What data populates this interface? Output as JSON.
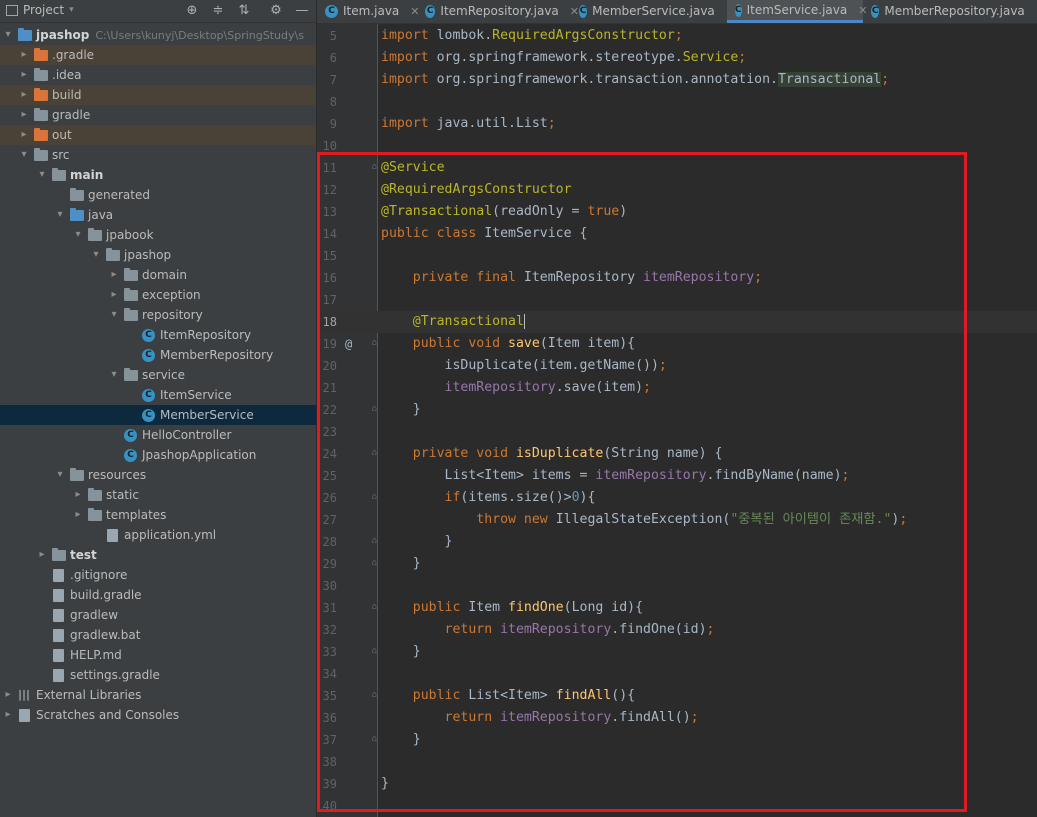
{
  "project_panel": {
    "title": "Project",
    "tree": [
      {
        "label": "jpashop",
        "path": "C:\\Users\\kunyj\\Desktop\\SpringStudy\\s",
        "bold": true,
        "icon": "folder-blue",
        "depth": 0,
        "arrow": "▾"
      },
      {
        "label": ".gradle",
        "icon": "folder-orange",
        "depth": 1,
        "arrow": "▸",
        "hl": true
      },
      {
        "label": ".idea",
        "icon": "folder",
        "depth": 1,
        "arrow": "▸"
      },
      {
        "label": "build",
        "icon": "folder-orange",
        "depth": 1,
        "arrow": "▸",
        "hl": true
      },
      {
        "label": "gradle",
        "icon": "folder",
        "depth": 1,
        "arrow": "▸"
      },
      {
        "label": "out",
        "icon": "folder-orange",
        "depth": 1,
        "arrow": "▸",
        "hl": true
      },
      {
        "label": "src",
        "icon": "folder",
        "depth": 1,
        "arrow": "▾"
      },
      {
        "label": "main",
        "bold": true,
        "icon": "folder",
        "depth": 2,
        "arrow": "▾"
      },
      {
        "label": "generated",
        "icon": "folder",
        "depth": 3,
        "arrow": ""
      },
      {
        "label": "java",
        "icon": "folder-blue",
        "depth": 3,
        "arrow": "▾"
      },
      {
        "label": "jpabook",
        "icon": "folder",
        "depth": 4,
        "arrow": "▾"
      },
      {
        "label": "jpashop",
        "icon": "folder",
        "depth": 5,
        "arrow": "▾"
      },
      {
        "label": "domain",
        "icon": "folder",
        "depth": 6,
        "arrow": "▸"
      },
      {
        "label": "exception",
        "icon": "folder",
        "depth": 6,
        "arrow": "▸"
      },
      {
        "label": "repository",
        "icon": "folder",
        "depth": 6,
        "arrow": "▾"
      },
      {
        "label": "ItemRepository",
        "icon": "class",
        "depth": 7,
        "arrow": ""
      },
      {
        "label": "MemberRepository",
        "icon": "class",
        "depth": 7,
        "arrow": ""
      },
      {
        "label": "service",
        "icon": "folder",
        "depth": 6,
        "arrow": "▾"
      },
      {
        "label": "ItemService",
        "icon": "class",
        "depth": 7,
        "arrow": ""
      },
      {
        "label": "MemberService",
        "icon": "class",
        "depth": 7,
        "arrow": "",
        "sel": true
      },
      {
        "label": "HelloController",
        "icon": "class",
        "depth": 6,
        "arrow": ""
      },
      {
        "label": "JpashopApplication",
        "icon": "class",
        "depth": 6,
        "arrow": ""
      },
      {
        "label": "resources",
        "icon": "folder",
        "depth": 3,
        "arrow": "▾"
      },
      {
        "label": "static",
        "icon": "folder",
        "depth": 4,
        "arrow": "▸"
      },
      {
        "label": "templates",
        "icon": "folder",
        "depth": 4,
        "arrow": "▸"
      },
      {
        "label": "application.yml",
        "icon": "file",
        "depth": 5,
        "arrow": ""
      },
      {
        "label": "test",
        "bold": true,
        "icon": "folder",
        "depth": 2,
        "arrow": "▸"
      },
      {
        "label": ".gitignore",
        "icon": "file",
        "depth": 2,
        "arrow": ""
      },
      {
        "label": "build.gradle",
        "icon": "file",
        "depth": 2,
        "arrow": ""
      },
      {
        "label": "gradlew",
        "icon": "file",
        "depth": 2,
        "arrow": ""
      },
      {
        "label": "gradlew.bat",
        "icon": "file",
        "depth": 2,
        "arrow": ""
      },
      {
        "label": "HELP.md",
        "icon": "file",
        "depth": 2,
        "arrow": ""
      },
      {
        "label": "settings.gradle",
        "icon": "file",
        "depth": 2,
        "arrow": ""
      },
      {
        "label": "External Libraries",
        "icon": "library",
        "depth": 0,
        "arrow": "▸"
      },
      {
        "label": "Scratches and Consoles",
        "icon": "scratch",
        "depth": 0,
        "arrow": "▸"
      }
    ]
  },
  "tabs": [
    {
      "label": "Item.java",
      "active": false
    },
    {
      "label": "ItemRepository.java",
      "active": false
    },
    {
      "label": "MemberService.java",
      "active": false
    },
    {
      "label": "ItemService.java",
      "active": true
    },
    {
      "label": "MemberRepository.java",
      "active": false
    }
  ],
  "editor": {
    "current_line": 18,
    "lines": [
      {
        "n": "5",
        "t": [
          [
            "kw",
            "import "
          ],
          [
            "mt",
            "lombok."
          ],
          [
            "an",
            "RequiredArgsConstructor"
          ],
          [
            "kw",
            ";"
          ]
        ]
      },
      {
        "n": "6",
        "t": [
          [
            "kw",
            "import "
          ],
          [
            "mt",
            "org.springframework.stereotype."
          ],
          [
            "an",
            "Service"
          ],
          [
            "kw",
            ";"
          ]
        ]
      },
      {
        "n": "7",
        "t": [
          [
            "kw",
            "import "
          ],
          [
            "mt",
            "org.springframework.transaction.annotation."
          ],
          [
            "annhl",
            "Transactional"
          ],
          [
            "kw",
            ";"
          ]
        ]
      },
      {
        "n": "8",
        "t": []
      },
      {
        "n": "9",
        "t": [
          [
            "kw",
            "import "
          ],
          [
            "mt",
            "java.util.List"
          ],
          [
            "kw",
            ";"
          ]
        ]
      },
      {
        "n": "10",
        "t": []
      },
      {
        "n": "11",
        "t": [
          [
            "an",
            "@Service"
          ]
        ]
      },
      {
        "n": "12",
        "t": [
          [
            "an",
            "@RequiredArgsConstructor"
          ]
        ]
      },
      {
        "n": "13",
        "t": [
          [
            "an",
            "@Transactional"
          ],
          [
            "mt",
            "(readOnly = "
          ],
          [
            "kw",
            "true"
          ],
          [
            "mt",
            ")"
          ]
        ]
      },
      {
        "n": "14",
        "t": [
          [
            "kw",
            "public class "
          ],
          [
            "mt",
            "ItemService {"
          ]
        ]
      },
      {
        "n": "15",
        "t": []
      },
      {
        "n": "16",
        "t": [
          [
            "mt",
            "    "
          ],
          [
            "kw",
            "private final "
          ],
          [
            "mt",
            "ItemRepository "
          ],
          [
            "fld",
            "itemRepository"
          ],
          [
            "kw",
            ";"
          ]
        ]
      },
      {
        "n": "17",
        "t": []
      },
      {
        "n": "18",
        "t": [
          [
            "mt",
            "    "
          ],
          [
            "an",
            "@Transactional"
          ]
        ]
      },
      {
        "n": "19",
        "t": [
          [
            "mt",
            "    "
          ],
          [
            "kw",
            "public void "
          ],
          [
            "fn",
            "save"
          ],
          [
            "mt",
            "(Item item){"
          ]
        ]
      },
      {
        "n": "20",
        "t": [
          [
            "mt",
            "        isDuplicate(item.getName())"
          ],
          [
            "kw",
            ";"
          ]
        ]
      },
      {
        "n": "21",
        "t": [
          [
            "mt",
            "        "
          ],
          [
            "fld",
            "itemRepository"
          ],
          [
            "mt",
            ".save(item)"
          ],
          [
            "kw",
            ";"
          ]
        ]
      },
      {
        "n": "22",
        "t": [
          [
            "mt",
            "    }"
          ]
        ]
      },
      {
        "n": "23",
        "t": []
      },
      {
        "n": "24",
        "t": [
          [
            "mt",
            "    "
          ],
          [
            "kw",
            "private void "
          ],
          [
            "fn",
            "isDuplicate"
          ],
          [
            "mt",
            "(String name) {"
          ]
        ]
      },
      {
        "n": "25",
        "t": [
          [
            "mt",
            "        List<Item> items = "
          ],
          [
            "fld",
            "itemRepository"
          ],
          [
            "mt",
            ".findByName(name)"
          ],
          [
            "kw",
            ";"
          ]
        ]
      },
      {
        "n": "26",
        "t": [
          [
            "mt",
            "        "
          ],
          [
            "kw",
            "if"
          ],
          [
            "mt",
            "(items.size()>"
          ],
          [
            "nm",
            "0"
          ],
          [
            "mt",
            "){"
          ]
        ]
      },
      {
        "n": "27",
        "t": [
          [
            "mt",
            "            "
          ],
          [
            "kw",
            "throw new "
          ],
          [
            "mt",
            "IllegalStateException("
          ],
          [
            "st",
            "\"중복된 아이템이 존재함.\""
          ],
          [
            "mt",
            ")"
          ],
          [
            "kw",
            ";"
          ]
        ]
      },
      {
        "n": "28",
        "t": [
          [
            "mt",
            "        }"
          ]
        ]
      },
      {
        "n": "29",
        "t": [
          [
            "mt",
            "    }"
          ]
        ]
      },
      {
        "n": "30",
        "t": []
      },
      {
        "n": "31",
        "t": [
          [
            "mt",
            "    "
          ],
          [
            "kw",
            "public "
          ],
          [
            "mt",
            "Item "
          ],
          [
            "fn",
            "findOne"
          ],
          [
            "mt",
            "(Long id){"
          ]
        ]
      },
      {
        "n": "32",
        "t": [
          [
            "mt",
            "        "
          ],
          [
            "kw",
            "return "
          ],
          [
            "fld",
            "itemRepository"
          ],
          [
            "mt",
            ".findOne(id)"
          ],
          [
            "kw",
            ";"
          ]
        ]
      },
      {
        "n": "33",
        "t": [
          [
            "mt",
            "    }"
          ]
        ]
      },
      {
        "n": "34",
        "t": []
      },
      {
        "n": "35",
        "t": [
          [
            "mt",
            "    "
          ],
          [
            "kw",
            "public "
          ],
          [
            "mt",
            "List<Item> "
          ],
          [
            "fn",
            "findAll"
          ],
          [
            "mt",
            "(){"
          ]
        ]
      },
      {
        "n": "36",
        "t": [
          [
            "mt",
            "        "
          ],
          [
            "kw",
            "return "
          ],
          [
            "fld",
            "itemRepository"
          ],
          [
            "mt",
            ".findAll()"
          ],
          [
            "kw",
            ";"
          ]
        ]
      },
      {
        "n": "37",
        "t": [
          [
            "mt",
            "    }"
          ]
        ]
      },
      {
        "n": "38",
        "t": []
      },
      {
        "n": "39",
        "t": [
          [
            "mt",
            "}"
          ]
        ]
      },
      {
        "n": "40",
        "t": []
      }
    ],
    "gutter_marks": {
      "19": "@"
    },
    "fold_lines": [
      "11",
      "19",
      "22",
      "24",
      "26",
      "28",
      "29",
      "31",
      "33",
      "35",
      "37"
    ]
  },
  "colors": {
    "highlight_box": "#e01b24",
    "selection": "#0d293e",
    "excluded_folder": "#4a4236"
  }
}
